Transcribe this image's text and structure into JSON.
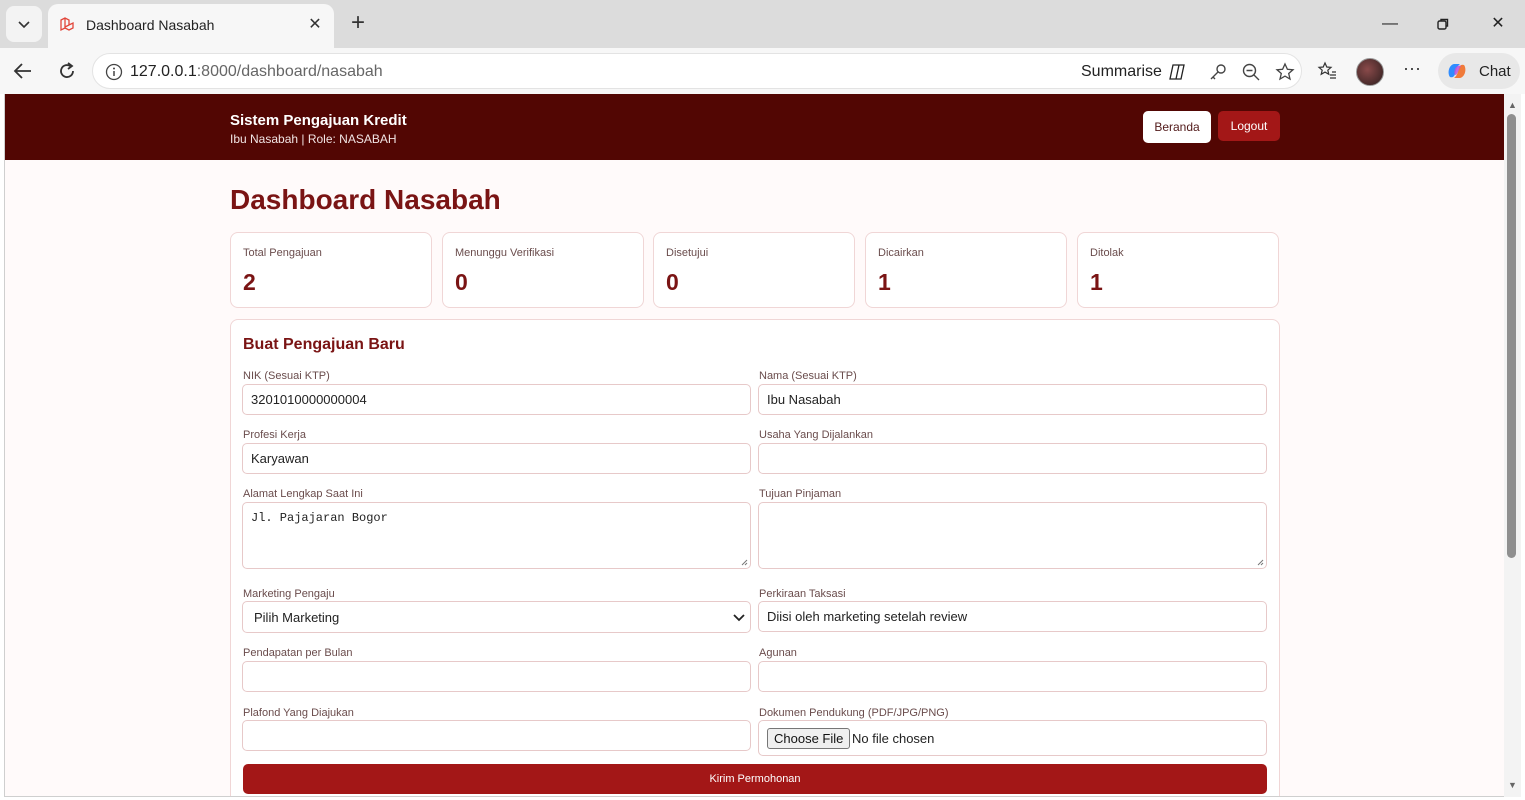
{
  "browser": {
    "tab_title": "Dashboard Nasabah",
    "url_host": "127.0.0.1",
    "url_rest": ":8000/dashboard/nasabah",
    "summarise_label": "Summarise",
    "chat_label": "Chat"
  },
  "header": {
    "app_title": "Sistem Pengajuan Kredit",
    "user_info": "Ibu Nasabah | Role: NASABAH",
    "beranda_label": "Beranda",
    "logout_label": "Logout",
    "bg_color": "#520603"
  },
  "page": {
    "title": "Dashboard Nasabah"
  },
  "stats": [
    {
      "label": "Total Pengajuan",
      "value": "2"
    },
    {
      "label": "Menunggu Verifikasi",
      "value": "0"
    },
    {
      "label": "Disetujui",
      "value": "0"
    },
    {
      "label": "Dicairkan",
      "value": "1"
    },
    {
      "label": "Ditolak",
      "value": "1"
    }
  ],
  "form": {
    "title": "Buat Pengajuan Baru",
    "nik": {
      "label": "NIK (Sesuai KTP)",
      "value": "3201010000000004"
    },
    "nama": {
      "label": "Nama (Sesuai KTP)",
      "value": "Ibu Nasabah"
    },
    "profesi": {
      "label": "Profesi Kerja",
      "value": "Karyawan"
    },
    "usaha": {
      "label": "Usaha Yang Dijalankan",
      "value": ""
    },
    "alamat": {
      "label": "Alamat Lengkap Saat Ini",
      "value": "Jl. Pajajaran Bogor"
    },
    "tujuan": {
      "label": "Tujuan Pinjaman",
      "value": ""
    },
    "marketing": {
      "label": "Marketing Pengaju",
      "value": "Pilih Marketing"
    },
    "taksasi": {
      "label": "Perkiraan Taksasi",
      "value": "Diisi oleh marketing setelah review"
    },
    "pendapatan": {
      "label": "Pendapatan per Bulan",
      "value": ""
    },
    "agunan": {
      "label": "Agunan",
      "value": ""
    },
    "plafond": {
      "label": "Plafond Yang Diajukan",
      "value": ""
    },
    "dokumen": {
      "label": "Dokumen Pendukung (PDF/JPG/PNG)",
      "button_label": "Choose File",
      "status": "No file chosen"
    },
    "submit_label": "Kirim Permohonan",
    "accent_color": "#a31717"
  }
}
